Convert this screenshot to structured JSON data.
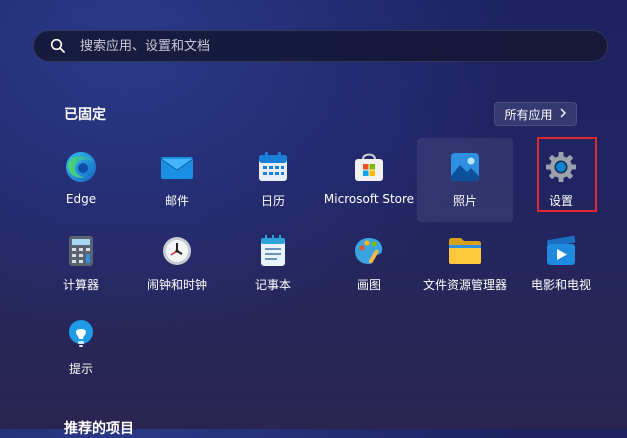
{
  "search": {
    "placeholder": "搜索应用、设置和文档",
    "icon": "search-icon"
  },
  "pinned": {
    "title": "已固定",
    "all_apps_label": "所有应用",
    "apps": [
      {
        "label": "Edge",
        "icon": "edge-icon"
      },
      {
        "label": "邮件",
        "icon": "mail-icon"
      },
      {
        "label": "日历",
        "icon": "calendar-icon"
      },
      {
        "label": "Microsoft Store",
        "icon": "store-icon"
      },
      {
        "label": "照片",
        "icon": "photos-icon"
      },
      {
        "label": "设置",
        "icon": "settings-icon"
      },
      {
        "label": "计算器",
        "icon": "calculator-icon"
      },
      {
        "label": "闹钟和时钟",
        "icon": "clock-icon"
      },
      {
        "label": "记事本",
        "icon": "notepad-icon"
      },
      {
        "label": "画图",
        "icon": "paint-icon"
      },
      {
        "label": "文件资源管理器",
        "icon": "folder-icon"
      },
      {
        "label": "电影和电视",
        "icon": "video-icon"
      },
      {
        "label": "提示",
        "icon": "tips-icon"
      }
    ]
  },
  "recommended": {
    "title": "推荐的项目"
  },
  "colors": {
    "highlight": "#e0282e",
    "accent": "#0a84d0"
  }
}
